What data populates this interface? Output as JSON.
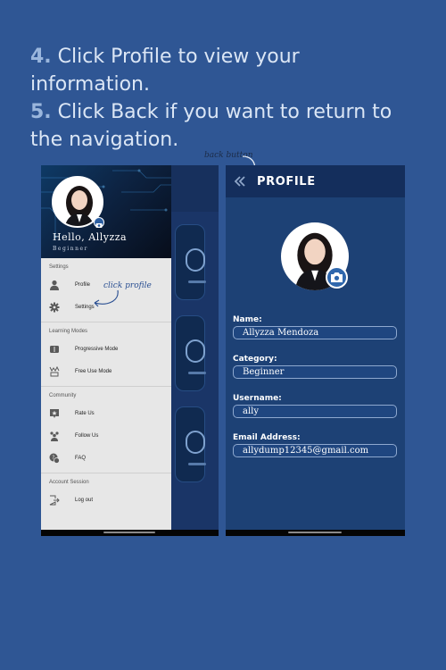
{
  "instructions": {
    "step4_num": "4.",
    "step4_text": " Click Profile to view your information.",
    "step5_num": "5.",
    "step5_text": " Click Back if you want to return to the navigation."
  },
  "annotations": {
    "click_profile": "click profile",
    "back_button": "back button"
  },
  "drawer": {
    "greeting": "Hello, Allyzza",
    "level": "Beginner",
    "sections": [
      {
        "title": "Settings",
        "items": [
          {
            "label": "Profile",
            "icon": "person-icon"
          },
          {
            "label": "Settings",
            "icon": "gear-icon"
          }
        ]
      },
      {
        "title": "Learning Modes",
        "items": [
          {
            "label": "Progressive Mode",
            "icon": "book-icon"
          },
          {
            "label": "Free Use Mode",
            "icon": "free-use-icon"
          }
        ]
      },
      {
        "title": "Community",
        "items": [
          {
            "label": "Rate Us",
            "icon": "star-badge-icon"
          },
          {
            "label": "Follow Us",
            "icon": "people-icon"
          },
          {
            "label": "FAQ",
            "icon": "faq-icon"
          }
        ]
      },
      {
        "title": "Account Session",
        "items": [
          {
            "label": "Log out",
            "icon": "logout-icon"
          }
        ]
      }
    ]
  },
  "profile": {
    "title": "PROFILE",
    "name_label": "Name:",
    "name_value": "Allyzza Mendoza",
    "category_label": "Category:",
    "category_value": "Beginner",
    "username_label": "Username:",
    "username_value": "ally",
    "email_label": "Email Address:",
    "email_value": "allydump12345@gmail.com"
  },
  "colors": {
    "background": "#2f5694",
    "drawer": "#e7e7e7",
    "profile_bg": "#1d4175",
    "accent": "#2f67ad"
  }
}
